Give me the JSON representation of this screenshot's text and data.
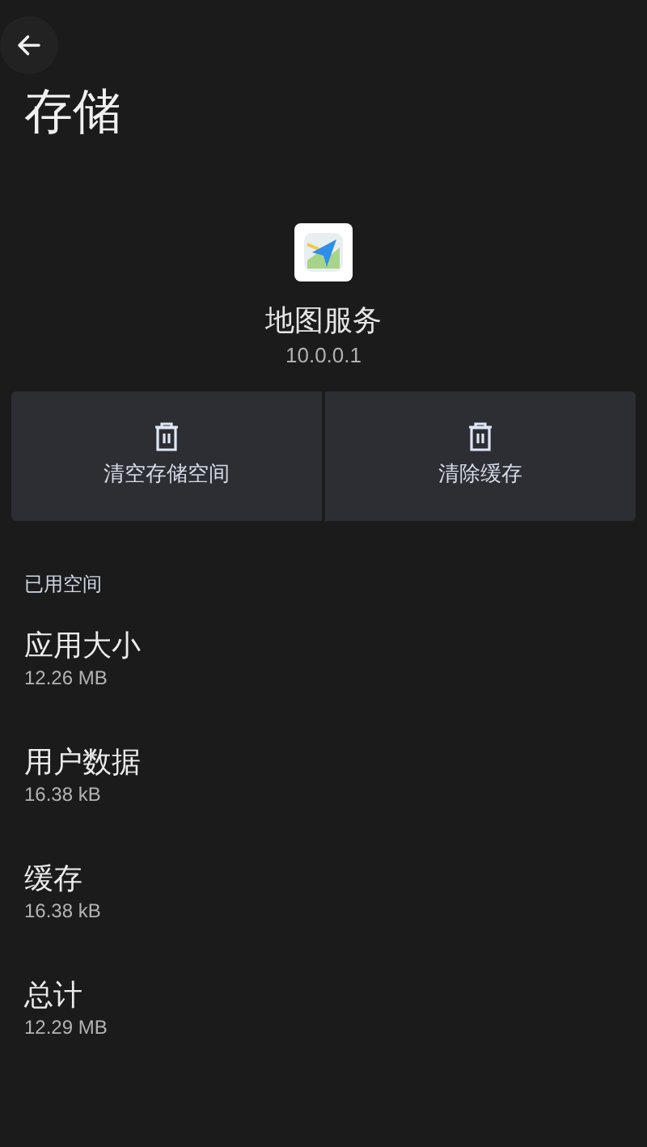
{
  "title": "存储",
  "app": {
    "name": "地图服务",
    "version": "10.0.0.1"
  },
  "actions": [
    {
      "label": "清空存储空间"
    },
    {
      "label": "清除缓存"
    }
  ],
  "section": {
    "title": "已用空间",
    "items": [
      {
        "label": "应用大小",
        "value": "12.26 MB"
      },
      {
        "label": "用户数据",
        "value": "16.38 kB"
      },
      {
        "label": "缓存",
        "value": "16.38 kB"
      },
      {
        "label": "总计",
        "value": "12.29 MB"
      }
    ]
  }
}
